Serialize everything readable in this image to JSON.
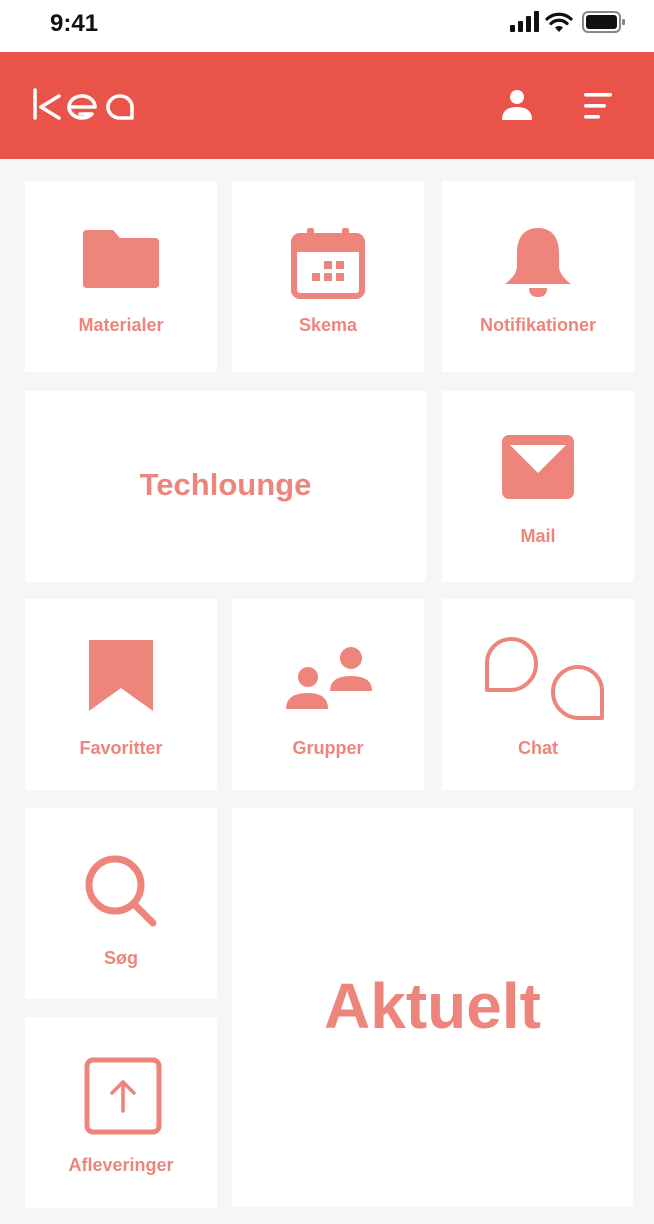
{
  "status_bar": {
    "time": "9:41"
  },
  "header": {
    "logo_text": "kea",
    "logo_icon": "kea-logo",
    "profile_icon": "user-icon",
    "menu_icon": "menu-icon"
  },
  "tiles": {
    "materialer": {
      "label": "Materialer",
      "icon": "folder-icon"
    },
    "skema": {
      "label": "Skema",
      "icon": "calendar-icon"
    },
    "notifikationer": {
      "label": "Notifikationer",
      "icon": "bell-icon"
    },
    "techlounge": {
      "label": "Techlounge"
    },
    "mail": {
      "label": "Mail",
      "icon": "mail-icon"
    },
    "favoritter": {
      "label": "Favoritter",
      "icon": "bookmark-icon"
    },
    "grupper": {
      "label": "Grupper",
      "icon": "group-icon"
    },
    "chat": {
      "label": "Chat",
      "icon": "chat-icon"
    },
    "soeg": {
      "label": "Søg",
      "icon": "search-icon"
    },
    "aktuelt": {
      "label": "Aktuelt"
    },
    "afleveringer": {
      "label": "Afleveringer",
      "icon": "upload-icon"
    }
  },
  "colors": {
    "header": "#e95349",
    "accent": "#ee857c",
    "background": "#f7f6f5",
    "tile": "#ffffff"
  }
}
